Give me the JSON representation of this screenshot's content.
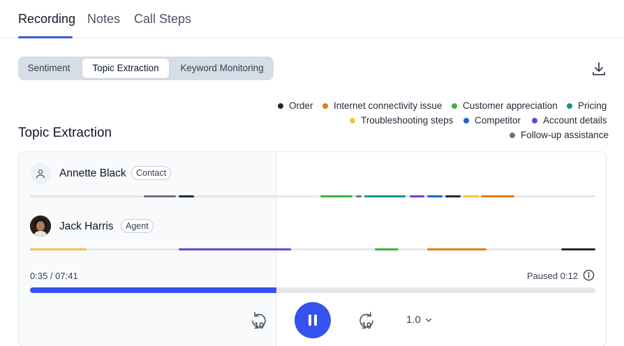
{
  "tabs": [
    {
      "label": "Recording",
      "active": true
    },
    {
      "label": "Notes",
      "active": false
    },
    {
      "label": "Call Steps",
      "active": false
    }
  ],
  "analysis_modes": [
    {
      "label": "Sentiment",
      "active": false
    },
    {
      "label": "Topic Extraction",
      "active": true
    },
    {
      "label": "Keyword Monitoring",
      "active": false
    }
  ],
  "icons": {
    "download": "download-icon",
    "contact_avatar": "user-icon",
    "info": "info-icon",
    "rewind": "rewind-10-icon",
    "forward": "forward-10-icon",
    "pause": "pause-icon",
    "speed_dropdown": "chevron-down-icon"
  },
  "legend": [
    {
      "label": "Order",
      "color": "#1f2937"
    },
    {
      "label": "Internet connectivity issue",
      "color": "#e8790f"
    },
    {
      "label": "Customer appreciation",
      "color": "#3fb244"
    },
    {
      "label": "Pricing",
      "color": "#11958f"
    },
    {
      "label": "Troubleshooting steps",
      "color": "#f6c344"
    },
    {
      "label": "Competitor",
      "color": "#1d64c8"
    },
    {
      "label": "Account details",
      "color": "#6547d4"
    },
    {
      "label": "Follow-up assistance",
      "color": "#6b7280"
    }
  ],
  "section_title": "Topic Extraction",
  "participants": [
    {
      "name": "Annette Black",
      "role": "Contact",
      "segments": [
        {
          "topic": "Follow-up assistance",
          "start": 0.201,
          "end": 0.258
        },
        {
          "topic": "Order",
          "start": 0.263,
          "end": 0.29
        },
        {
          "topic": "Customer appreciation",
          "start": 0.513,
          "end": 0.571
        },
        {
          "topic": "Follow-up assistance",
          "start": 0.576,
          "end": 0.587
        },
        {
          "topic": "Pricing",
          "start": 0.591,
          "end": 0.664
        },
        {
          "topic": "Account details",
          "start": 0.671,
          "end": 0.698
        },
        {
          "topic": "Competitor",
          "start": 0.703,
          "end": 0.73
        },
        {
          "topic": "Order",
          "start": 0.734,
          "end": 0.762
        },
        {
          "topic": "Troubleshooting steps",
          "start": 0.767,
          "end": 0.794
        },
        {
          "topic": "Internet connectivity issue",
          "start": 0.798,
          "end": 0.857
        }
      ]
    },
    {
      "name": "Jack Harris",
      "role": "Agent",
      "segments": [
        {
          "topic": "Troubleshooting steps",
          "start": 0.0,
          "end": 0.1
        },
        {
          "topic": "Account details",
          "start": 0.263,
          "end": 0.462
        },
        {
          "topic": "Customer appreciation",
          "start": 0.61,
          "end": 0.652
        },
        {
          "topic": "Internet connectivity issue",
          "start": 0.703,
          "end": 0.808
        },
        {
          "topic": "Order",
          "start": 0.939,
          "end": 1.0
        }
      ]
    }
  ],
  "player": {
    "time_display": "0:35 / 07:41",
    "paused_display": "Paused 0:12",
    "progress": 0.436,
    "rewind_label": "10",
    "forward_label": "10",
    "speed": "1.0"
  }
}
